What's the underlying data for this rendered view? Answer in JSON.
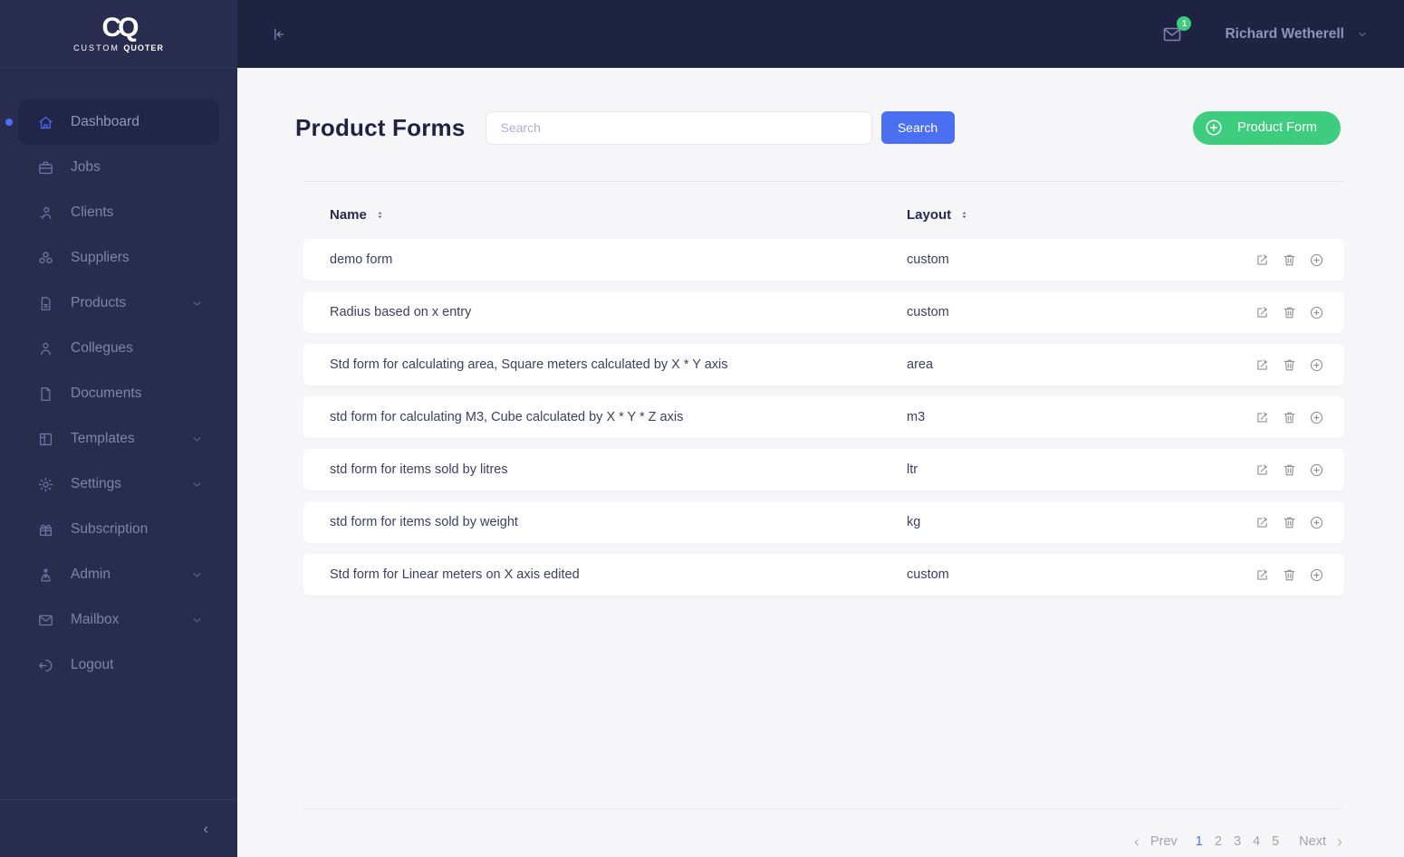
{
  "brand": {
    "initials": "CQ",
    "name_light": "CUSTOM ",
    "name_bold": "QUOTER"
  },
  "topbar": {
    "user_name": "Richard Wetherell",
    "mail_badge": "1"
  },
  "sidebar": {
    "items": [
      {
        "label": "Dashboard",
        "icon": "home",
        "active": true,
        "chevron": false
      },
      {
        "label": "Jobs",
        "icon": "briefcase",
        "active": false,
        "chevron": false
      },
      {
        "label": "Clients",
        "icon": "clients",
        "active": false,
        "chevron": false
      },
      {
        "label": "Suppliers",
        "icon": "cubes",
        "active": false,
        "chevron": false
      },
      {
        "label": "Products",
        "icon": "product",
        "active": false,
        "chevron": true
      },
      {
        "label": "Collegues",
        "icon": "person",
        "active": false,
        "chevron": false
      },
      {
        "label": "Documents",
        "icon": "document",
        "active": false,
        "chevron": false
      },
      {
        "label": "Templates",
        "icon": "template",
        "active": false,
        "chevron": true
      },
      {
        "label": "Settings",
        "icon": "gear",
        "active": false,
        "chevron": true
      },
      {
        "label": "Subscription",
        "icon": "gift",
        "active": false,
        "chevron": false
      },
      {
        "label": "Admin",
        "icon": "admin",
        "active": false,
        "chevron": true
      },
      {
        "label": "Mailbox",
        "icon": "mail",
        "active": false,
        "chevron": true
      },
      {
        "label": "Logout",
        "icon": "logout",
        "active": false,
        "chevron": false
      }
    ]
  },
  "page": {
    "title": "Product Forms",
    "search_placeholder": "Search",
    "search_button": "Search",
    "add_button": "Product Form"
  },
  "table": {
    "columns": [
      {
        "label": "Name"
      },
      {
        "label": "Layout"
      }
    ],
    "rows": [
      {
        "name": "demo form",
        "layout": "custom"
      },
      {
        "name": "Radius based on x entry",
        "layout": "custom"
      },
      {
        "name": "Std form for calculating area, Square meters calculated by X * Y axis",
        "layout": "area"
      },
      {
        "name": "std form for calculating M3, Cube calculated by X * Y * Z axis",
        "layout": "m3"
      },
      {
        "name": "std form for items sold by litres",
        "layout": "ltr"
      },
      {
        "name": "std form for items sold by weight",
        "layout": "kg"
      },
      {
        "name": "Std form for Linear meters on X axis edited",
        "layout": "custom"
      }
    ]
  },
  "pagination": {
    "prev": "Prev",
    "next": "Next",
    "pages": [
      "1",
      "2",
      "3",
      "4",
      "5"
    ],
    "active_page": "1"
  },
  "colors": {
    "accent_blue": "#4a6ff0",
    "accent_green": "#3ecc7e",
    "sidebar_bg": "#282c4e",
    "topbar_bg": "#1f2342",
    "content_bg": "#f6f6f8"
  }
}
